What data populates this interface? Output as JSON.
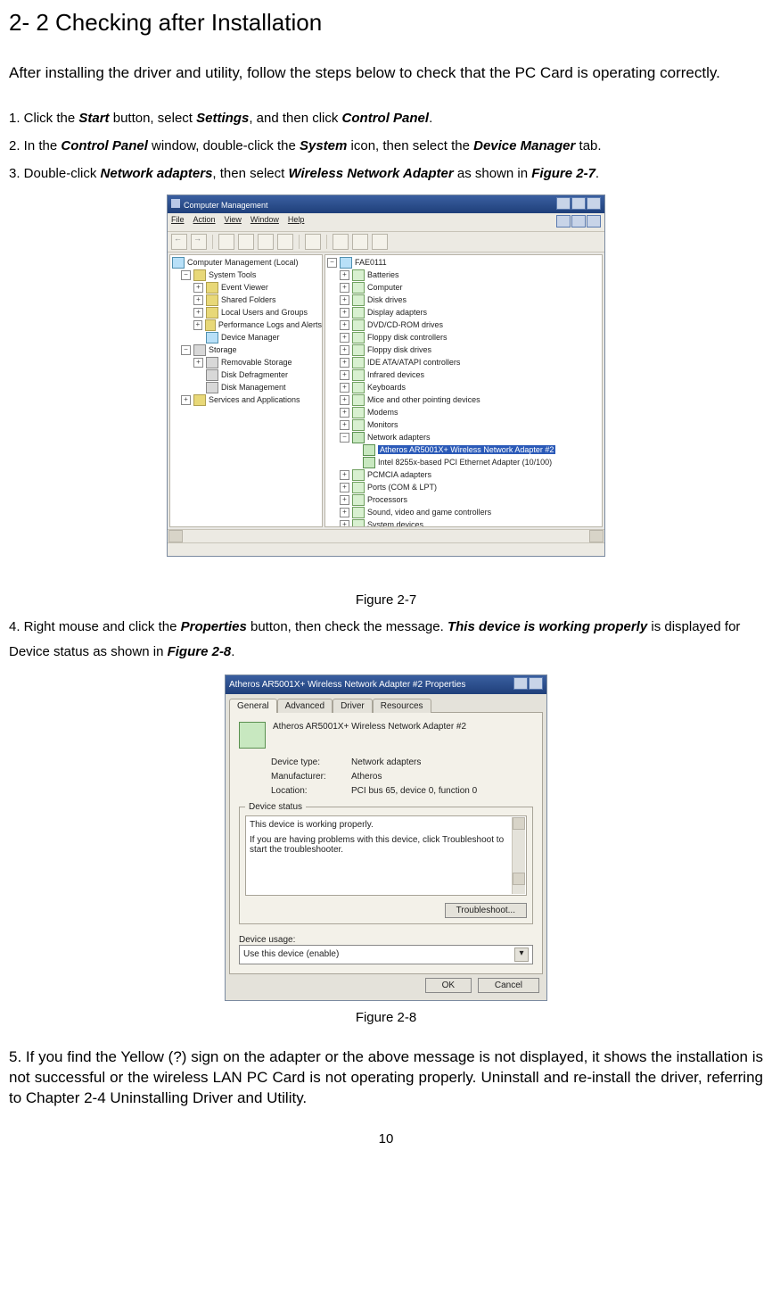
{
  "section_title": "2- 2 Checking after Installation",
  "intro": "After installing the driver and utility, follow the steps below to check that the PC Card is operating correctly.",
  "steps": {
    "s1_pre": "1.  Click the ",
    "s1_b1": "Start",
    "s1_mid1": " button, select ",
    "s1_b2": "Settings",
    "s1_mid2": ", and then click ",
    "s1_b3": "Control Panel",
    "s1_post": ".",
    "s2_pre": "2.  In the ",
    "s2_b1": "Control Panel",
    "s2_mid1": " window, double-click the ",
    "s2_b2": "System",
    "s2_mid2": " icon, then select the ",
    "s2_b3": "Device Manager",
    "s2_post": " tab.",
    "s3_pre": "3.  Double-click ",
    "s3_b1": "Network adapters",
    "s3_mid1": ", then select ",
    "s3_b2": "Wireless Network Adapter",
    "s3_mid2": " as shown in ",
    "s3_b3": "Figure 2-7",
    "s3_post": ".",
    "s4_pre": "4.  Right mouse and click the ",
    "s4_b1": "Properties",
    "s4_mid1": " button, then check the message. ",
    "s4_b2": "This device is working properly",
    "s4_mid2": " is displayed for Device status as shown in ",
    "s4_b3": "Figure 2-8",
    "s4_post": ".",
    "s5": "5. If you find the Yellow (?) sign on the adapter or the above message is not displayed, it shows the installation is not successful or the wireless LAN PC Card is not operating properly. Uninstall and re-install the driver, referring to Chapter 2-4 Uninstalling Driver and Utility."
  },
  "fig27_caption": "Figure 2-7",
  "fig28_caption": "Figure 2-8",
  "page_number": "10",
  "fig27": {
    "title": "Computer Management",
    "menus": [
      "File",
      "Action",
      "View",
      "Window",
      "Help"
    ],
    "left_root": "Computer Management (Local)",
    "left_tree": [
      "System Tools",
      "Event Viewer",
      "Shared Folders",
      "Local Users and Groups",
      "Performance Logs and Alerts",
      "Device Manager",
      "Storage",
      "Removable Storage",
      "Disk Defragmenter",
      "Disk Management",
      "Services and Applications"
    ],
    "right_root": "FAE0111",
    "right_tree": [
      "Batteries",
      "Computer",
      "Disk drives",
      "Display adapters",
      "DVD/CD-ROM drives",
      "Floppy disk controllers",
      "Floppy disk drives",
      "IDE ATA/ATAPI controllers",
      "Infrared devices",
      "Keyboards",
      "Mice and other pointing devices",
      "Modems",
      "Monitors",
      "Network adapters"
    ],
    "right_sel": "Atheros AR5001X+ Wireless Network Adapter #2",
    "right_sub2": "Intel 8255x-based PCI Ethernet Adapter (10/100)",
    "right_tree2": [
      "PCMCIA adapters",
      "Ports (COM & LPT)",
      "Processors",
      "Sound, video and game controllers",
      "System devices"
    ]
  },
  "fig28": {
    "title": "Atheros AR5001X+ Wireless Network Adapter #2 Properties",
    "tabs": [
      "General",
      "Advanced",
      "Driver",
      "Resources"
    ],
    "dev_name": "Atheros AR5001X+ Wireless Network Adapter #2",
    "k_type": "Device type:",
    "v_type": "Network adapters",
    "k_mfr": "Manufacturer:",
    "v_mfr": "Atheros",
    "k_loc": "Location:",
    "v_loc": "PCI bus 65, device 0, function 0",
    "grp_status": "Device status",
    "status1": "This device is working properly.",
    "status2": "If you are having problems with this device, click Troubleshoot to start the troubleshooter.",
    "btn_ts": "Troubleshoot...",
    "grp_usage": "Device usage:",
    "usage_val": "Use this device (enable)",
    "btn_ok": "OK",
    "btn_cancel": "Cancel"
  }
}
